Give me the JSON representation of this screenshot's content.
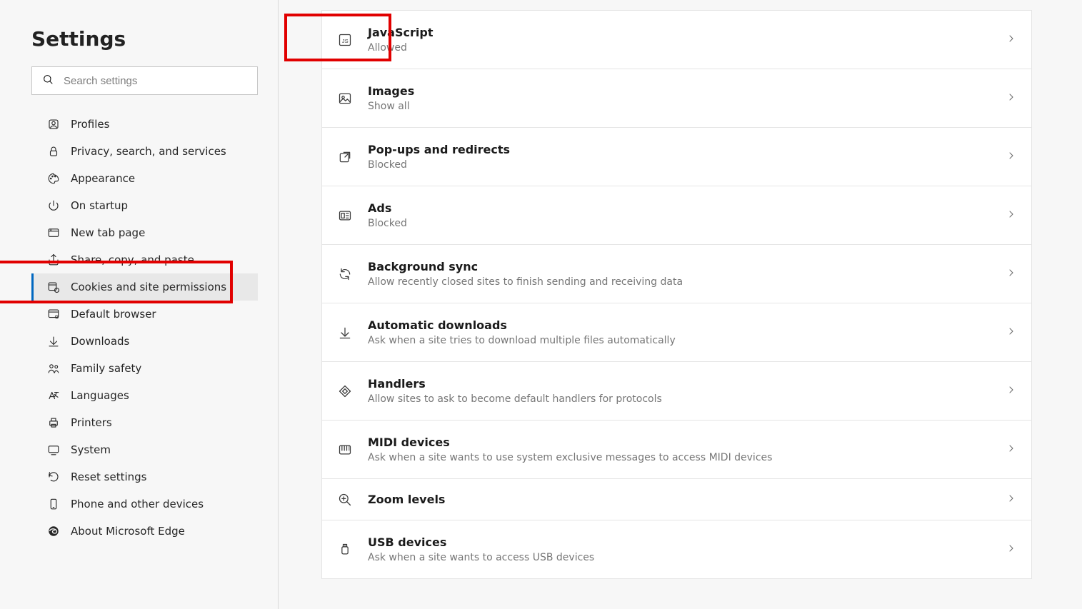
{
  "sidebar": {
    "title": "Settings",
    "search_placeholder": "Search settings",
    "items": [
      {
        "label": "Profiles",
        "icon": "profile"
      },
      {
        "label": "Privacy, search, and services",
        "icon": "lock"
      },
      {
        "label": "Appearance",
        "icon": "paint"
      },
      {
        "label": "On startup",
        "icon": "power"
      },
      {
        "label": "New tab page",
        "icon": "tab"
      },
      {
        "label": "Share, copy, and paste",
        "icon": "share"
      },
      {
        "label": "Cookies and site permissions",
        "icon": "cookie",
        "selected": true
      },
      {
        "label": "Default browser",
        "icon": "browser"
      },
      {
        "label": "Downloads",
        "icon": "download"
      },
      {
        "label": "Family safety",
        "icon": "family"
      },
      {
        "label": "Languages",
        "icon": "language"
      },
      {
        "label": "Printers",
        "icon": "printer"
      },
      {
        "label": "System",
        "icon": "system"
      },
      {
        "label": "Reset settings",
        "icon": "reset"
      },
      {
        "label": "Phone and other devices",
        "icon": "phone"
      },
      {
        "label": "About Microsoft Edge",
        "icon": "edge"
      }
    ]
  },
  "permissions": [
    {
      "title": "JavaScript",
      "sub": "Allowed",
      "icon": "js",
      "highlight": true
    },
    {
      "title": "Images",
      "sub": "Show all",
      "icon": "image"
    },
    {
      "title": "Pop-ups and redirects",
      "sub": "Blocked",
      "icon": "popup"
    },
    {
      "title": "Ads",
      "sub": "Blocked",
      "icon": "ads"
    },
    {
      "title": "Background sync",
      "sub": "Allow recently closed sites to finish sending and receiving data",
      "icon": "sync"
    },
    {
      "title": "Automatic downloads",
      "sub": "Ask when a site tries to download multiple files automatically",
      "icon": "download"
    },
    {
      "title": "Handlers",
      "sub": "Allow sites to ask to become default handlers for protocols",
      "icon": "handlers"
    },
    {
      "title": "MIDI devices",
      "sub": "Ask when a site wants to use system exclusive messages to access MIDI devices",
      "icon": "midi"
    },
    {
      "title": "Zoom levels",
      "sub": "",
      "icon": "zoom"
    },
    {
      "title": "USB devices",
      "sub": "Ask when a site wants to access USB devices",
      "icon": "usb"
    }
  ]
}
